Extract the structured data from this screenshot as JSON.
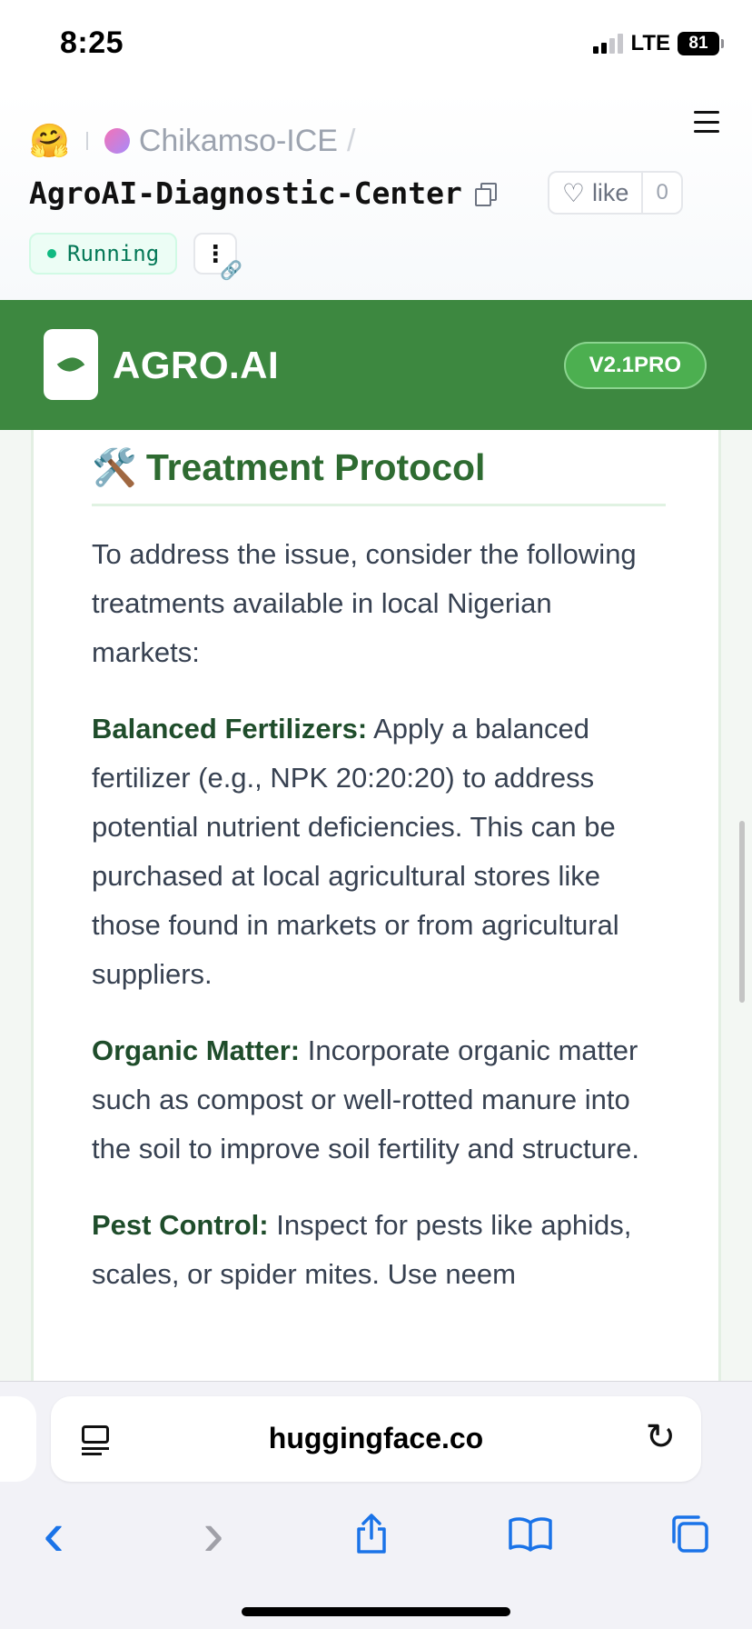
{
  "status_bar": {
    "time": "8:25",
    "network": "LTE",
    "battery": "81"
  },
  "hf_header": {
    "logo_icon": "hugging-face-emoji",
    "owner": "Chikamso-ICE",
    "separator": "/",
    "space_name": "AgroAI-Diagnostic-Center",
    "like_label": "like",
    "like_count": "0",
    "status": "Running"
  },
  "app_header": {
    "title": "AGRO.AI",
    "version": "V2.1PRO",
    "logo_icon": "leaf-icon"
  },
  "content": {
    "section_icon": "🛠️",
    "section_title": "Treatment Protocol",
    "intro": "To address the issue, consider the following treatments available in local Nigerian markets:",
    "items": [
      {
        "label": "Balanced Fertilizers:",
        "text": " Apply a balanced fertilizer (e.g., NPK 20:20:20) to address potential nutrient deficiencies. This can be purchased at local agricultural stores like those found in markets or from agricultural suppliers."
      },
      {
        "label": "Organic Matter:",
        "text": " Incorporate organic matter such as compost or well-rotted manure into the soil to improve soil fertility and structure."
      },
      {
        "label": "Pest Control:",
        "text": " Inspect for pests like aphids, scales, or spider mites. Use neem"
      }
    ]
  },
  "browser": {
    "url": "huggingface.co",
    "nav": {
      "back": "‹",
      "forward": "›"
    }
  }
}
